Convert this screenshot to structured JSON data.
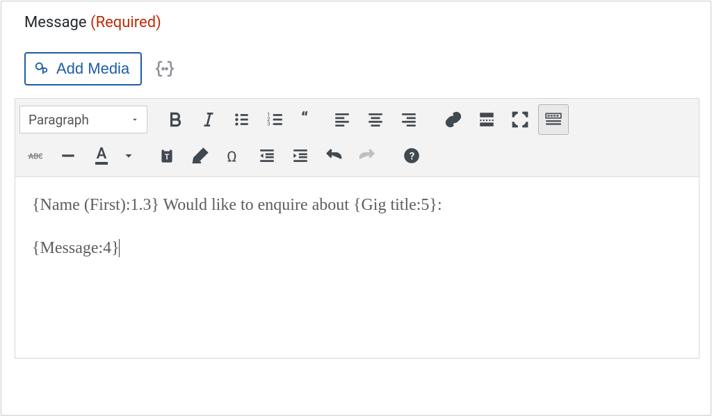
{
  "field": {
    "label": "Message",
    "required_text": "(Required)"
  },
  "actions": {
    "add_media_label": "Add Media"
  },
  "toolbar": {
    "format_selector": "Paragraph"
  },
  "editor": {
    "paragraph1": "{Name (First):1.3} Would like to enquire about {Gig title:5}:",
    "paragraph2": "{Message:4}"
  }
}
